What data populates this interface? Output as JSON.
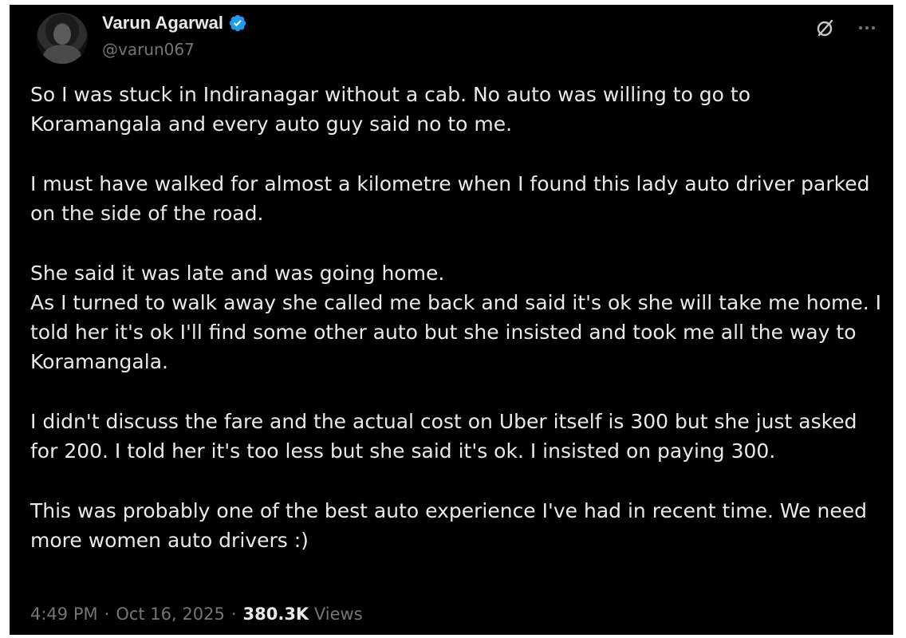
{
  "author": {
    "display_name": "Varun Agarwal",
    "handle": "@varun067",
    "verified": true,
    "verified_color": "#1d9bf0"
  },
  "icons": {
    "avatar": "profile-photo",
    "verified": "verified-badge-icon",
    "grok": "grok-icon",
    "more": "more-options-icon"
  },
  "tweet": {
    "paragraphs": [
      "So I was stuck in Indiranagar without a cab. No auto was willing to go to Koramangala and every auto guy said no to me.",
      "I must have walked for almost a kilometre when I found this lady auto driver parked on the side of the road.",
      "She said it was late and was going home.",
      "As I turned to walk away she called me back and said it's ok she will take me home. I told her it's ok I'll find some other auto but she insisted and took me all the way to Koramangala.",
      "I didn't discuss the fare and the actual cost on Uber itself is 300 but she just asked for 200. I told her it's too less but she said it's ok. I insisted on paying 300.",
      "This was probably one of the best auto experience I've had in recent time. We need more women auto drivers :)"
    ]
  },
  "meta": {
    "time": "4:49 PM",
    "separator": "·",
    "date": "Oct 16, 2025",
    "views_count": "380.3K",
    "views_label": "Views"
  },
  "colors": {
    "background": "#000000",
    "text_primary": "#e7e9ea",
    "text_secondary": "#71767b"
  }
}
